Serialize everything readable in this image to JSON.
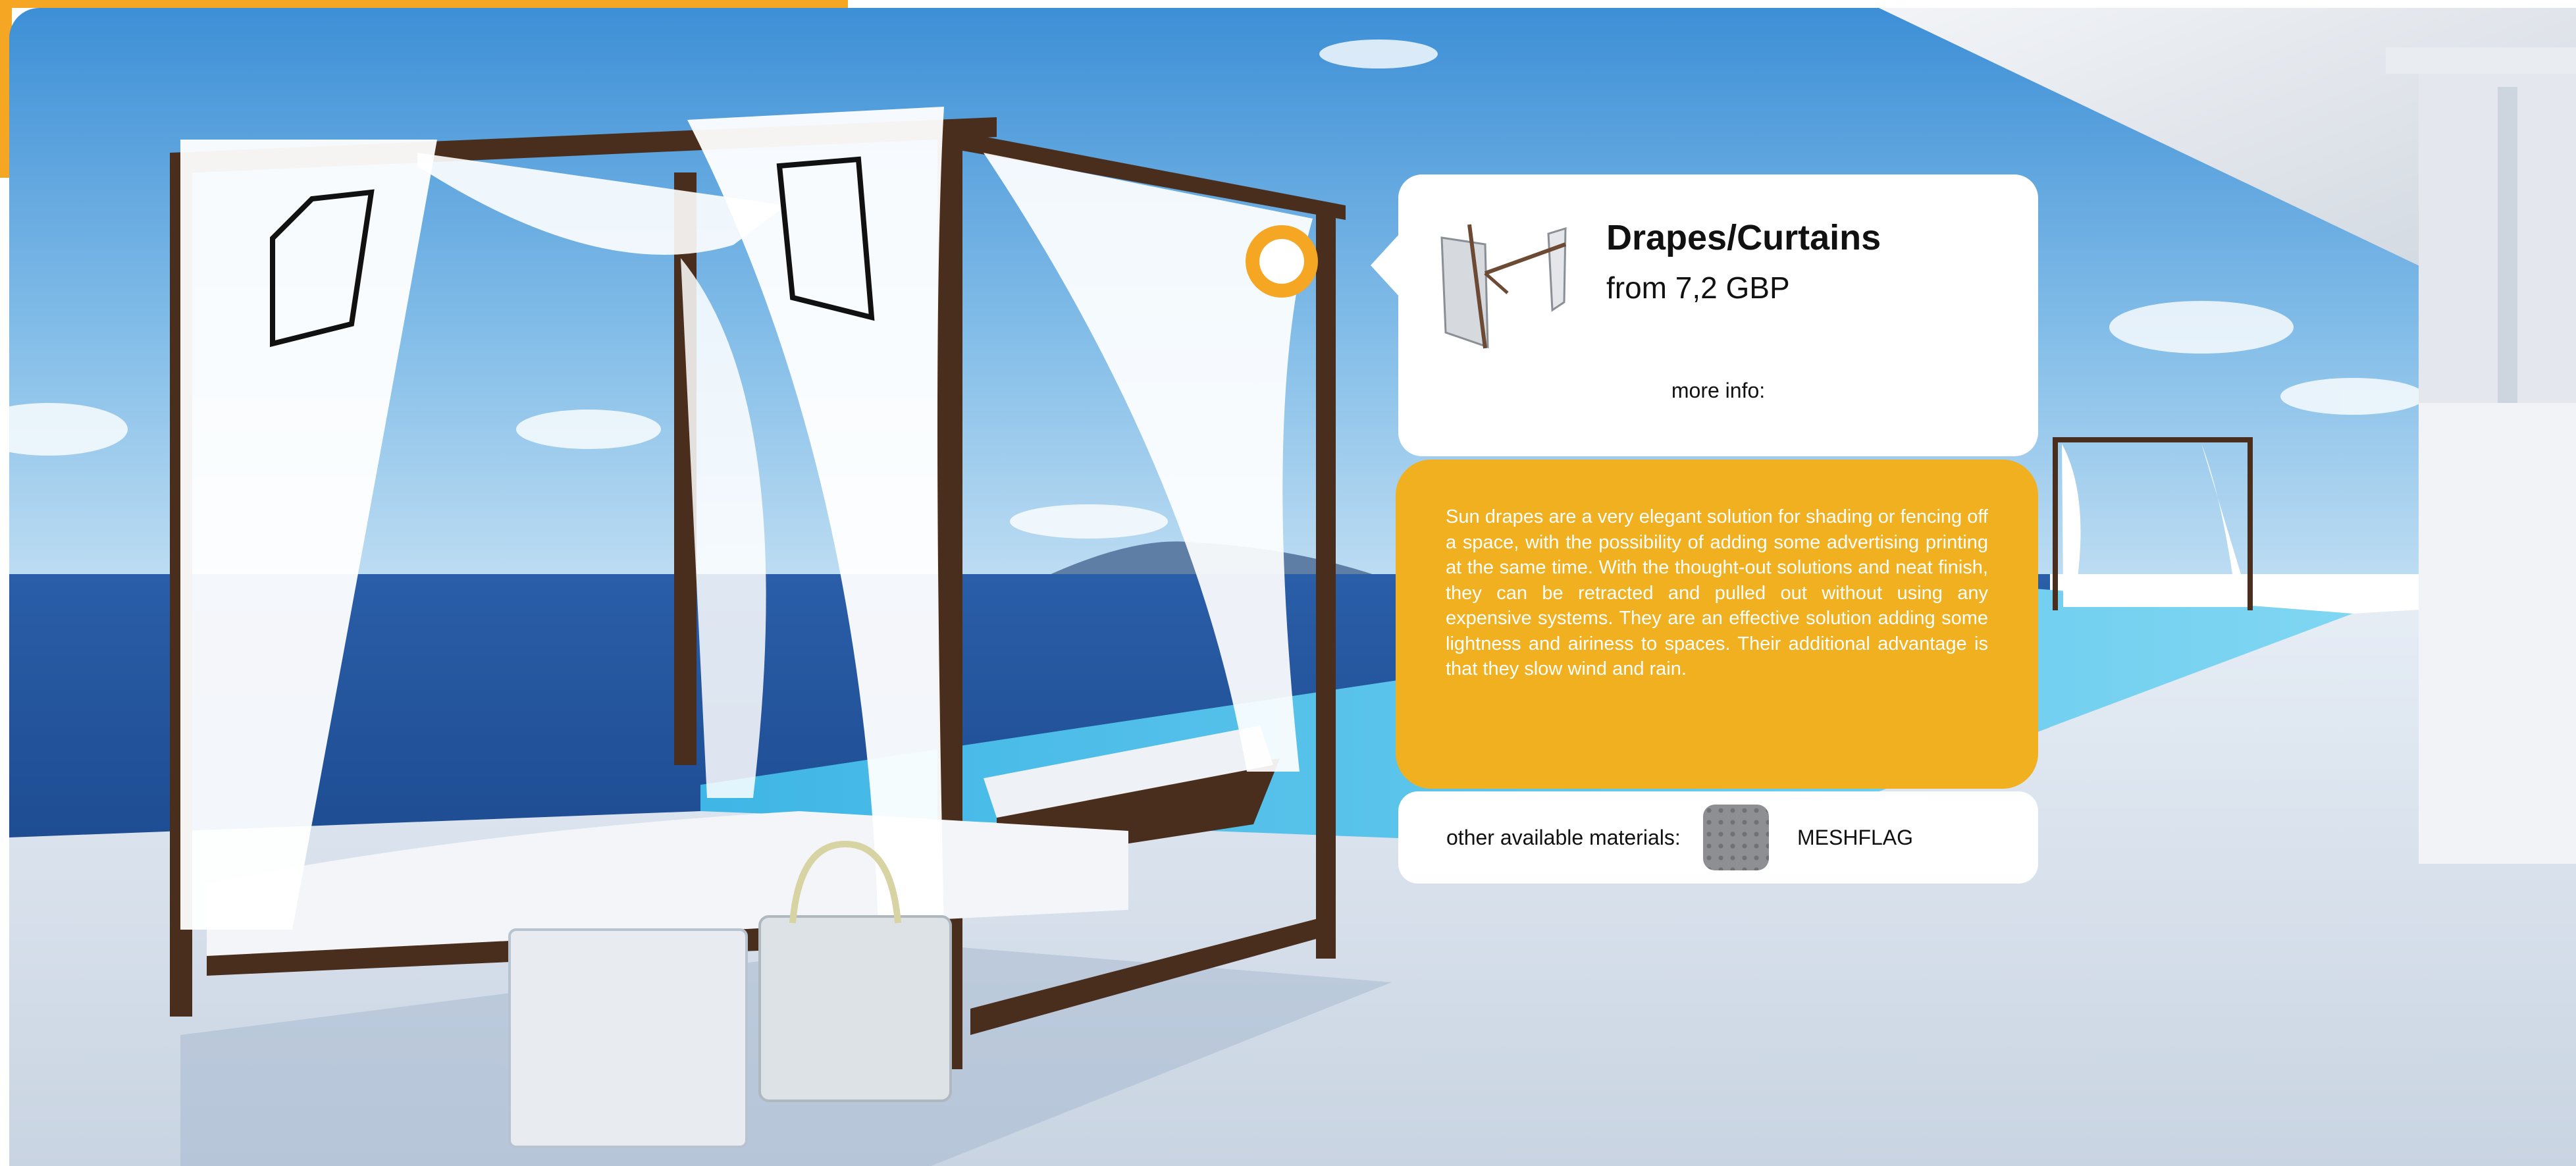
{
  "colors": {
    "accent": "#f5a623",
    "description_panel": "#f0b01f",
    "card": "#ffffff",
    "text_dark": "#111111",
    "text_light": "#ffffff"
  },
  "scene": {
    "description": "Luxury poolside daybed with white drapes overlooking the sea",
    "icons": [
      "hotspot-marker",
      "product-thumbnail",
      "material-swatch"
    ]
  },
  "product": {
    "title": "Drapes/Curtains",
    "price": "from 7,2 GBP",
    "more_info_label": "more info:",
    "description": "Sun drapes are a very elegant solution for shading or fencing off a space, with the possibility of adding some advertising printing at the same time. With the thought-out solutions and neat finish, they can be retracted and pulled out without using any expensive systems.      They are an effective solution adding some lightness and airiness to spaces. Their additional advantage is that they slow wind and rain."
  },
  "materials": {
    "label": "other available materials:",
    "items": [
      {
        "name": "MESHFLAG",
        "swatch_color": "#8d8f93"
      }
    ]
  }
}
